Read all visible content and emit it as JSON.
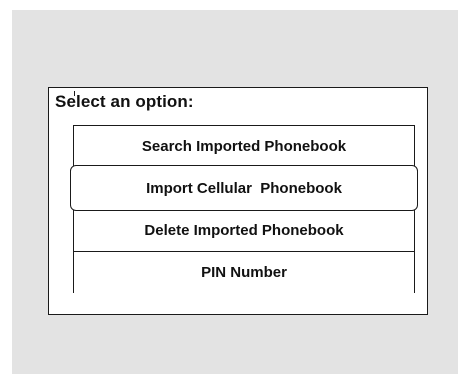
{
  "dialog": {
    "prompt": "Select an option:"
  },
  "menu": {
    "selected_index": 1,
    "items": [
      {
        "label": "Search Imported Phonebook"
      },
      {
        "label": "Import Cellular  Phonebook"
      },
      {
        "label": "Delete Imported Phonebook"
      },
      {
        "label": "PIN Number"
      }
    ]
  }
}
